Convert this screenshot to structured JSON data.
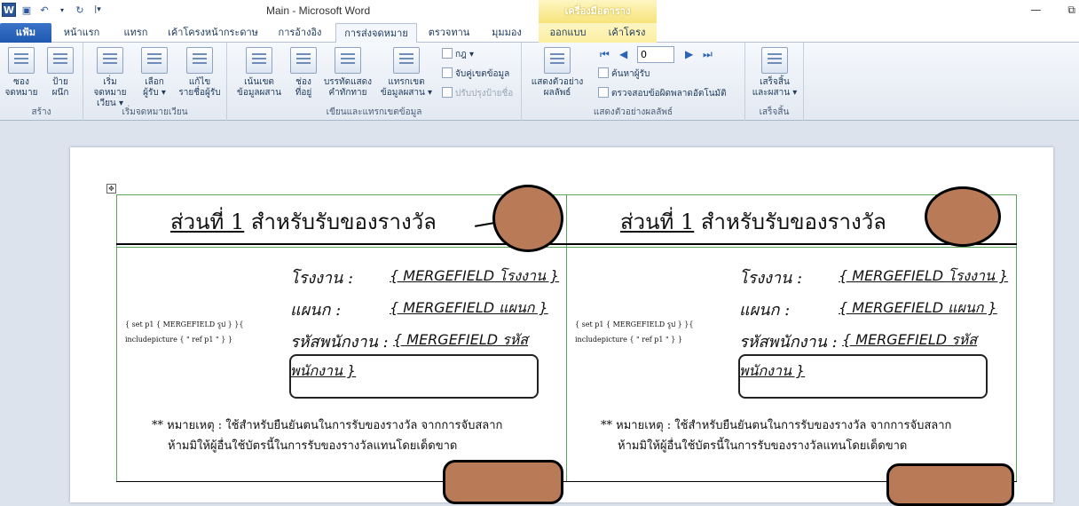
{
  "titlebar": {
    "title": "Main  -  Microsoft Word",
    "context_title": "เครื่องมือตาราง",
    "qat": [
      "W",
      "💾",
      "↶",
      "↻"
    ]
  },
  "tabs": {
    "file": "แฟ้ม",
    "home": "หน้าแรก",
    "insert": "แทรก",
    "page_layout": "เค้าโครงหน้ากระดาษ",
    "references": "การอ้างอิง",
    "mailings": "การส่งจดหมาย",
    "review": "ตรวจทาน",
    "view": "มุมมอง",
    "design": "ออกแบบ",
    "layout": "เค้าโครง"
  },
  "ribbon": {
    "create": {
      "label": "สร้าง",
      "envelopes": "ซอง\nจดหมาย",
      "labels": "ป้าย\nผนึก"
    },
    "start_merge": {
      "label": "เริ่มจดหมายเวียน",
      "start": "เริ่มจดหมาย\nเวียน ▾",
      "select": "เลือก\nผู้รับ ▾",
      "edit": "แก้ไข\nรายชื่อผู้รับ"
    },
    "write_insert": {
      "label": "เขียนและแทรกเขตข้อมูล",
      "highlight": "เน้นเขต\nข้อมูลผสาน",
      "address_block": "ช่อง\nที่อยู่",
      "greeting": "บรรทัดแสดง\nคำทักทาย",
      "insert_field": "แทรกเขต\nข้อมูลผสาน ▾",
      "rules": "กฎ ▾",
      "match_fields": "จับคู่เขตข้อมูล",
      "update_labels": "ปรับปรุงป้ายชื่อ"
    },
    "preview": {
      "label": "แสดงตัวอย่างผลลัพธ์",
      "preview_results": "แสดงตัวอย่าง\nผลลัพธ์",
      "record": "0",
      "find_recipient": "ค้นหาผู้รับ",
      "auto_check": "ตรวจสอบข้อผิดพลาดอัตโนมัติ"
    },
    "finish": {
      "label": "เสร็จสิ้น",
      "finish_merge": "เสร็จสิ้น\nและผสาน ▾"
    }
  },
  "document": {
    "heading_part": "ส่วนที่ 1",
    "heading_rest": " สำหรับรับของรางวัล",
    "factory_label": "โรงงาน :",
    "factory_value": "{ MERGEFIELD โรงงาน }",
    "dept_label": "แผนก :",
    "dept_value": "{ MERGEFIELD แผนก }",
    "empid_label": "รหัสพนักงาน :",
    "empid_value_1": "{ MERGEFIELD รหัส",
    "empid_value_2": "พนักงาน }",
    "code_line1": "{ set p1 { MERGEFIELD รูป } }{",
    "code_line2": "includepicture { \" ref p1 \" } }",
    "note_line1": "** หมายเหตุ : ใช้สำหรับยืนยันตนในการรับของรางวัล จากการจับสลาก",
    "note_line2": "ห้ามมิให้ผู้อื่นใช้บัตรนี้ในการรับของรางวัลแทนโดยเด็ดขาด"
  },
  "colors": {
    "blob": "#b97a57",
    "gridline": "#5aa55a",
    "file_tab": "#2b5fb4"
  }
}
